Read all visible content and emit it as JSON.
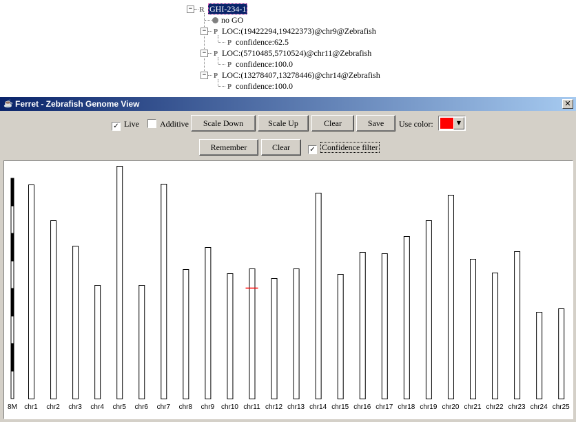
{
  "tree": {
    "root": {
      "icon": "R",
      "label": "GHI-234-1"
    },
    "items": [
      {
        "icon": "dot",
        "label": "no GO"
      },
      {
        "icon": "P",
        "label": "LOC:(19422294,19422373)@chr9@Zebrafish"
      },
      {
        "icon": "P",
        "label": "confidence:62.5"
      },
      {
        "icon": "P",
        "label": "LOC:(5710485,5710524)@chr11@Zebrafish"
      },
      {
        "icon": "P",
        "label": "confidence:100.0"
      },
      {
        "icon": "P",
        "label": "LOC:(13278407,13278446)@chr14@Zebrafish"
      },
      {
        "icon": "P",
        "label": "confidence:100.0"
      }
    ]
  },
  "window": {
    "title": "Ferret - Zebrafish Genome View",
    "close_glyph": "✕"
  },
  "toolbar": {
    "live_label": "Live",
    "live_checked": true,
    "additive_label": "Additive",
    "additive_checked": false,
    "scale_down_label": "Scale Down",
    "scale_up_label": "Scale Up",
    "clear_label": "Clear",
    "save_label": "Save",
    "use_color_label": "Use color:",
    "selected_color": "#ff0000"
  },
  "toolbar2": {
    "remember_label": "Remember",
    "clear_label": "Clear",
    "confidence_label": "Confidence filter",
    "confidence_checked": true
  },
  "chart_data": {
    "type": "bar",
    "scale_label": "8M",
    "categories": [
      "chr1",
      "chr2",
      "chr3",
      "chr4",
      "chr5",
      "chr6",
      "chr7",
      "chr8",
      "chr9",
      "chr10",
      "chr11",
      "chr12",
      "chr13",
      "chr14",
      "chr15",
      "chr16",
      "chr17",
      "chr18",
      "chr19",
      "chr20",
      "chr21",
      "chr22",
      "chr23",
      "chr24",
      "chr25"
    ],
    "values": [
      62.2,
      51.8,
      44.4,
      33.0,
      67.6,
      33.0,
      62.4,
      37.6,
      44.0,
      36.4,
      37.8,
      35.0,
      37.8,
      59.8,
      36.2,
      42.6,
      42.2,
      47.2,
      51.8,
      59.2,
      40.6,
      36.6,
      42.8,
      25.2,
      26.2
    ],
    "ylim": [
      0,
      64
    ],
    "scale_bar_unit": 8,
    "marker": {
      "chromosome": "chr11",
      "position": 5.710485,
      "color": "#ff0000"
    }
  }
}
